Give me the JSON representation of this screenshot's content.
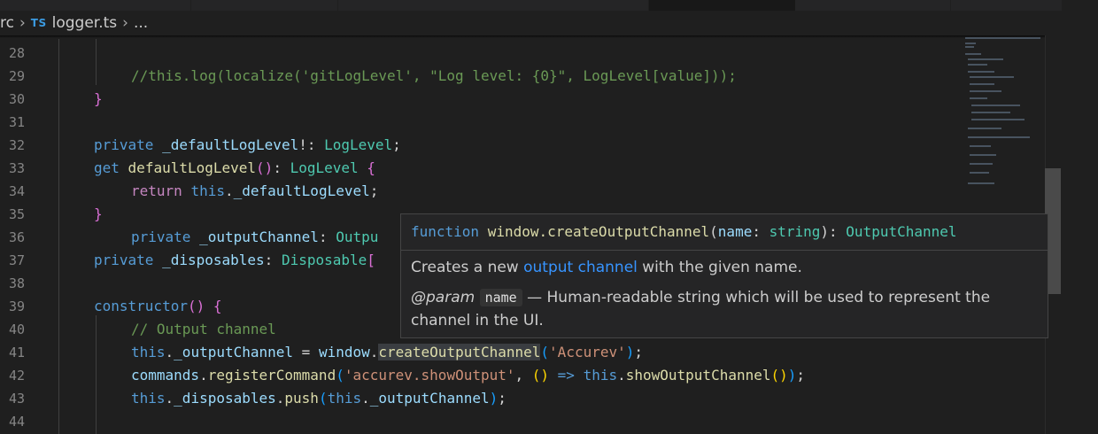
{
  "breadcrumb": {
    "folder": "rc",
    "file_icon": "TS",
    "file": "logger.ts",
    "more": "..."
  },
  "line_numbers": [
    "28",
    "29",
    "30",
    "31",
    "32",
    "33",
    "34",
    "35",
    "36",
    "37",
    "38",
    "39",
    "40",
    "41",
    "42",
    "43",
    "44"
  ],
  "code": {
    "l29_comment": "//this.log(localize('gitLogLevel', \"Log level: {0}\", LogLevel[value]));",
    "l32": {
      "private": "private",
      "name": "_defaultLogLevel",
      "bang": "!: ",
      "type": "LogLevel",
      "semi": ";"
    },
    "l33": {
      "get": "get",
      "name": "defaultLogLevel",
      "parens": "()",
      "colon": ": ",
      "type": "LogLevel",
      "brace": " {"
    },
    "l34": {
      "return": "return",
      "this": "this",
      "dot": ".",
      "prop": "_defaultLogLevel",
      "semi": ";"
    },
    "l35": {
      "brace": "}"
    },
    "l36": {
      "private": "private",
      "name": "_outputChannel",
      "colon": ": ",
      "type_partial": "Outpu"
    },
    "l37": {
      "private": "private",
      "name": "_disposables",
      "colon": ": ",
      "type": "Disposable",
      "bracket": "["
    },
    "l39": {
      "ctor": "constructor",
      "parens": "()",
      "brace": " {"
    },
    "l40": {
      "comment": "// Output channel"
    },
    "l41": {
      "this": "this",
      "dot1": ".",
      "prop": "_outputChannel",
      "eq": " = ",
      "obj": "window",
      "dot2": ".",
      "fn": "createOutputChannel",
      "open": "(",
      "str": "'Accurev'",
      "close": ")",
      "semi": ";"
    },
    "l42": {
      "obj": "commands",
      "dot": ".",
      "fn": "registerCommand",
      "open": "(",
      "str": "'accurev.showOutput'",
      "comma": ", ",
      "arrow_parens": "()",
      "arrow": " => ",
      "this": "this",
      "dot2": ".",
      "fn2": "showOutputChannel",
      "inner": "()",
      "close": ")",
      "semi": ";"
    },
    "l43": {
      "this": "this",
      "dot": ".",
      "prop": "_disposables",
      "dot2": ".",
      "fn": "push",
      "open": "(",
      "this2": "this",
      "dot3": ".",
      "prop2": "_outputChannel",
      "close": ")",
      "semi": ";"
    },
    "l30_brace": "}"
  },
  "hover": {
    "sig_keyword": "function",
    "sig_name": "window.createOutputChannel",
    "sig_open": "(",
    "sig_param": "name",
    "sig_colon": ": ",
    "sig_param_type": "string",
    "sig_close": "): ",
    "sig_return": "OutputChannel",
    "desc_before": "Creates a new ",
    "desc_link": "output channel",
    "desc_after": " with the given name.",
    "param_tag": "@param",
    "param_name": "name",
    "param_desc": " — Human-readable string which will be used to represent the channel in the UI."
  },
  "colors": {
    "background": "#1f1f1f",
    "keyword": "#569cd6",
    "control": "#c586c0",
    "function": "#dcdcaa",
    "type": "#4ec9b0",
    "property": "#9cdcfe",
    "string": "#ce9178",
    "comment": "#6a9955",
    "link": "#3794ff"
  }
}
